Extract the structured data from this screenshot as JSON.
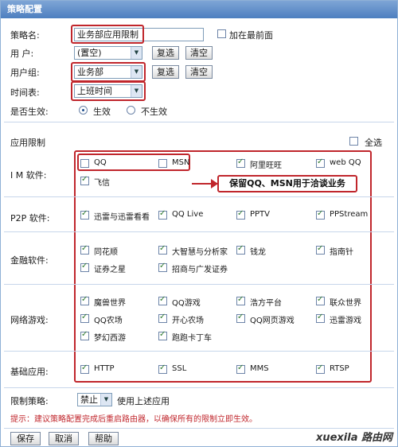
{
  "window": {
    "title": "策略配置"
  },
  "form": {
    "policy_name_label": "策略名:",
    "policy_name_value": "业务部应用限制",
    "add_to_front_label": "加在最前面",
    "user_label": "用 户:",
    "user_select": "(置空)",
    "select_button": "复选",
    "clear_button": "清空",
    "user_group_label": "用户组:",
    "user_group_select": "业务部",
    "schedule_label": "时间表:",
    "schedule_select": "上班时间",
    "enabled_label": "是否生效:",
    "enabled_option": "生效",
    "disabled_option": "不生效"
  },
  "app_limit": {
    "section_label": "应用限制",
    "select_all_label": "全选",
    "categories": [
      {
        "label": "I M 软件:",
        "items": [
          {
            "label": "QQ",
            "checked": false
          },
          {
            "label": "MSN",
            "checked": false
          },
          {
            "label": "阿里旺旺",
            "checked": true
          },
          {
            "label": "web QQ",
            "checked": true
          },
          {
            "label": "飞信",
            "checked": true
          }
        ]
      },
      {
        "label": "P2P 软件:",
        "items": [
          {
            "label": "迅雷与迅雷看看",
            "checked": true
          },
          {
            "label": "QQ Live",
            "checked": true
          },
          {
            "label": "PPTV",
            "checked": true
          },
          {
            "label": "PPStream",
            "checked": true
          }
        ]
      },
      {
        "label": "金融软件:",
        "items": [
          {
            "label": "同花顺",
            "checked": true
          },
          {
            "label": "大智慧与分析家",
            "checked": true
          },
          {
            "label": "钱龙",
            "checked": true
          },
          {
            "label": "指南针",
            "checked": true
          },
          {
            "label": "证券之星",
            "checked": true
          },
          {
            "label": "招商与广发证券",
            "checked": true
          }
        ]
      },
      {
        "label": "网络游戏:",
        "items": [
          {
            "label": "魔兽世界",
            "checked": true
          },
          {
            "label": "QQ游戏",
            "checked": true
          },
          {
            "label": "浩方平台",
            "checked": true
          },
          {
            "label": "联众世界",
            "checked": true
          },
          {
            "label": "QQ农场",
            "checked": true
          },
          {
            "label": "开心农场",
            "checked": true
          },
          {
            "label": "QQ网页游戏",
            "checked": true
          },
          {
            "label": "迅雷游戏",
            "checked": true
          },
          {
            "label": "梦幻西游",
            "checked": true
          },
          {
            "label": "跑跑卡丁车",
            "checked": true
          }
        ]
      },
      {
        "label": "基础应用:",
        "items": [
          {
            "label": "HTTP",
            "checked": true
          },
          {
            "label": "SSL",
            "checked": true
          },
          {
            "label": "MMS",
            "checked": true
          },
          {
            "label": "RTSP",
            "checked": true
          }
        ]
      }
    ],
    "callout_text": "保留QQ、MSN用于洽谈业务"
  },
  "policy": {
    "label": "限制策略:",
    "select": "禁止",
    "suffix": "使用上述应用"
  },
  "hint": "提示：建议策略配置完成后重启路由器，以确保所有的限制立即生效。",
  "buttons": {
    "save": "保存",
    "cancel": "取消",
    "help": "帮助"
  },
  "watermark": "xuexila 路由网",
  "colors": {
    "title_bar": "#4d7fc0",
    "highlight": "#c0262c",
    "hint": "#c0262c"
  }
}
